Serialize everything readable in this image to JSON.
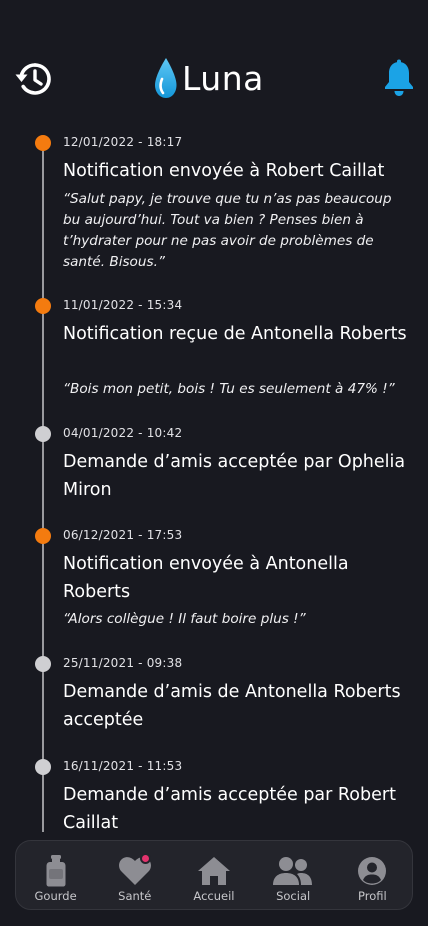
{
  "app": {
    "name": "Luna"
  },
  "header": {
    "history_icon": "history-icon",
    "bell_icon": "bell-icon",
    "accent_color": "#1ba3e6"
  },
  "timeline": {
    "accent_color": "#f47b0f",
    "entries": [
      {
        "date": "12/01/2022 - 18:17",
        "title": "Notification envoyée à Robert Caillat",
        "quote": "“Salut papy, je trouve que tu n’as pas beaucoup bu aujourd’hui. Tout va bien ? Penses bien à t’hydrater pour ne pas avoir de problèmes de santé. Bisous.”",
        "type": "notification"
      },
      {
        "date": "11/01/2022 - 15:34",
        "title": "Notification reçue de Antonella Roberts",
        "quote": "“Bois mon petit, bois ! Tu es seulement à 47% !”",
        "type": "notification"
      },
      {
        "date": "04/01/2022 - 10:42",
        "title": "Demande d’amis acceptée par Ophelia Miron",
        "quote": "",
        "type": "friend"
      },
      {
        "date": "06/12/2021 - 17:53",
        "title": "Notification envoyée à Antonella Roberts",
        "quote": "“Alors collègue ! Il faut boire plus !”",
        "type": "notification"
      },
      {
        "date": "25/11/2021 - 09:38",
        "title": "Demande d’amis de Antonella Roberts acceptée",
        "quote": "",
        "type": "friend"
      },
      {
        "date": "16/11/2021 - 11:53",
        "title": "Demande d’amis acceptée par Robert Caillat",
        "quote": "",
        "type": "friend"
      }
    ]
  },
  "nav": {
    "items": [
      {
        "label": "Gourde",
        "icon": "bottle-icon"
      },
      {
        "label": "Santé",
        "icon": "heart-icon",
        "badge": true
      },
      {
        "label": "Accueil",
        "icon": "home-icon"
      },
      {
        "label": "Social",
        "icon": "people-icon"
      },
      {
        "label": "Profil",
        "icon": "user-icon"
      }
    ],
    "badge_color": "#e3336d"
  }
}
